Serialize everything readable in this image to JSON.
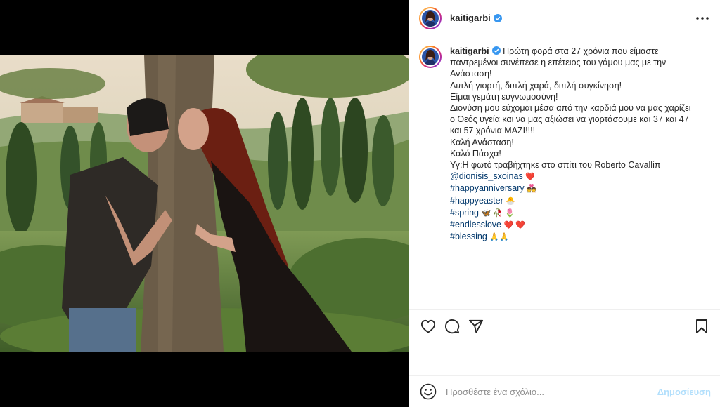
{
  "post": {
    "username": "kaitigarbi",
    "verified": true,
    "caption_lines": [
      "Πρώτη φορά στα 27 χρόνια που είμαστε",
      "παντρεμένοι συνέπεσε η επέτειος του γάμου μας με την",
      "Ανάσταση!",
      "Διπλή γιορτή, διπλή χαρά, διπλή συγκίνηση!",
      "Είμαι γεμάτη ευγνωμοσύνη!",
      "Διονύση μου εύχομαι μέσα από την καρδιά μου να μας χαρίζει",
      "ο Θεός υγεία και να μας αξιώσει να γιορτάσουμε και 37 και 47",
      "και 57 χρόνια ΜΑΖΙ!!!!",
      "Καλή Ανάσταση!",
      "Καλό Πάσχα!",
      "Υγ:Η φωτό τραβήχτηκε στο σπίτι του Roberto Cavalliπ"
    ],
    "tags": [
      {
        "text": "@dionisis_sxoinas",
        "emoji": "❤️"
      },
      {
        "text": "#happyanniversary",
        "emoji": "💑"
      },
      {
        "text": "#happyeaster",
        "emoji": "🐣"
      },
      {
        "text": "#spring",
        "emoji": "🦋 🥀 🌷"
      },
      {
        "text": "#endlesslove",
        "emoji": "❤️ ❤️"
      },
      {
        "text": "#blessing",
        "emoji": "🙏🙏"
      }
    ]
  },
  "icons": {
    "more": "more-options-icon",
    "like": "heart-icon",
    "comment": "comment-icon",
    "share": "share-icon",
    "save": "bookmark-icon",
    "emoji": "emoji-icon"
  },
  "comment": {
    "placeholder": "Προσθέστε ένα σχόλιο...",
    "post_label": "Δημοσίευση"
  },
  "colors": {
    "verified_blue": "#3897f0",
    "link_blue": "#00376b",
    "post_disabled": "#b2dffc"
  }
}
